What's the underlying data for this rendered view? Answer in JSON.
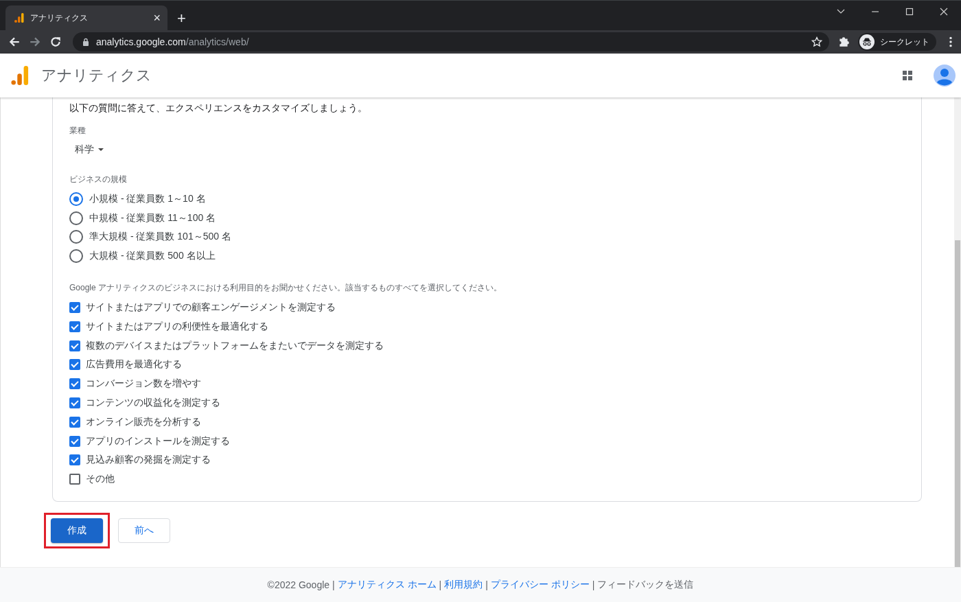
{
  "browser": {
    "tab_title": "アナリティクス",
    "close_tab": "×",
    "new_tab": "+",
    "url_host": "analytics.google.com",
    "url_path": "/analytics/web/",
    "profile_label": "シークレット"
  },
  "app": {
    "title": "アナリティクス"
  },
  "form": {
    "intro": "以下の質問に答えて、エクスペリエンスをカスタマイズしましょう。",
    "industry": {
      "label": "業種",
      "value": "科学"
    },
    "size": {
      "label": "ビジネスの規模",
      "options": [
        {
          "label": "小規模 - 従業員数 1～10 名",
          "selected": true
        },
        {
          "label": "中規模 - 従業員数 11～100 名",
          "selected": false
        },
        {
          "label": "準大規模 - 従業員数 101～500 名",
          "selected": false
        },
        {
          "label": "大規模 - 従業員数 500 名以上",
          "selected": false
        }
      ]
    },
    "purpose": {
      "label": "Google アナリティクスのビジネスにおける利用目的をお聞かせください。該当するものすべてを選択してください。",
      "options": [
        {
          "label": "サイトまたはアプリでの顧客エンゲージメントを測定する",
          "checked": true
        },
        {
          "label": "サイトまたはアプリの利便性を最適化する",
          "checked": true
        },
        {
          "label": "複数のデバイスまたはプラットフォームをまたいでデータを測定する",
          "checked": true
        },
        {
          "label": "広告費用を最適化する",
          "checked": true
        },
        {
          "label": "コンバージョン数を増やす",
          "checked": true
        },
        {
          "label": "コンテンツの収益化を測定する",
          "checked": true
        },
        {
          "label": "オンライン販売を分析する",
          "checked": true
        },
        {
          "label": "アプリのインストールを測定する",
          "checked": true
        },
        {
          "label": "見込み顧客の発掘を測定する",
          "checked": true
        },
        {
          "label": "その他",
          "checked": false
        }
      ]
    }
  },
  "actions": [
    {
      "label": "作成",
      "kind": "primary",
      "highlighted": true
    },
    {
      "label": "前へ",
      "kind": "secondary",
      "highlighted": false
    }
  ],
  "footer": [
    {
      "kind": "text",
      "text": "©2022 Google"
    },
    {
      "kind": "sep",
      "text": "|"
    },
    {
      "kind": "link",
      "text": "アナリティクス ホーム"
    },
    {
      "kind": "sep",
      "text": "|"
    },
    {
      "kind": "link",
      "text": "利用規約"
    },
    {
      "kind": "sep",
      "text": "|"
    },
    {
      "kind": "link",
      "text": "プライバシー ポリシー"
    },
    {
      "kind": "sep",
      "text": "|"
    },
    {
      "kind": "text",
      "text": "フィードバックを送信"
    }
  ]
}
